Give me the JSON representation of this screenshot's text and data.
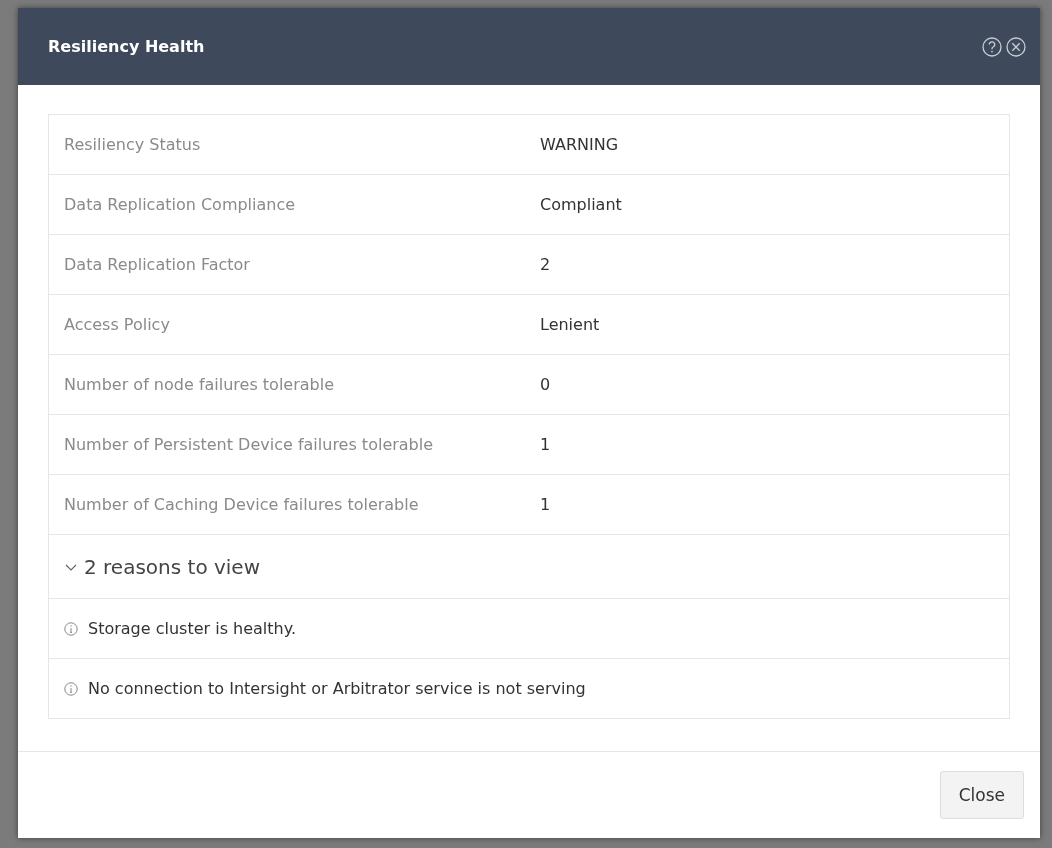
{
  "dialog": {
    "title": "Resiliency Health"
  },
  "properties": [
    {
      "label": "Resiliency Status",
      "value": "WARNING"
    },
    {
      "label": "Data Replication Compliance",
      "value": "Compliant"
    },
    {
      "label": "Data Replication Factor",
      "value": "2"
    },
    {
      "label": "Access Policy",
      "value": "Lenient"
    },
    {
      "label": "Number of node failures tolerable",
      "value": "0"
    },
    {
      "label": "Number of Persistent Device failures tolerable",
      "value": "1"
    },
    {
      "label": "Number of Caching Device failures tolerable",
      "value": "1"
    }
  ],
  "reasons": {
    "label": "2 reasons to view",
    "expanded": true,
    "items": [
      "Storage cluster is healthy.",
      "No connection to Intersight or Arbitrator service is not serving"
    ]
  },
  "buttons": [
    "Close"
  ]
}
